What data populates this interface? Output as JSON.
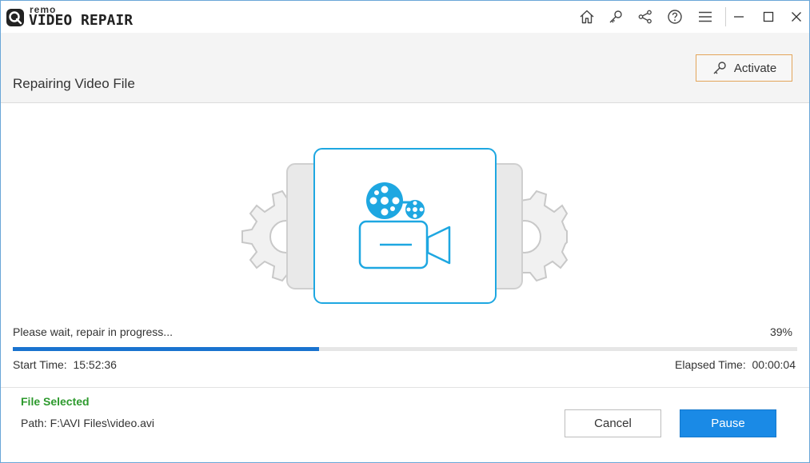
{
  "app": {
    "logo_small": "remo",
    "logo_big": "VIDEO REPAIR"
  },
  "titlebar": {
    "icons": [
      "home-icon",
      "key-icon",
      "share-icon",
      "help-icon",
      "menu-icon",
      "minimize-icon",
      "maximize-icon",
      "close-icon"
    ]
  },
  "header": {
    "title": "Repairing Video File",
    "activate_label": "Activate"
  },
  "progress": {
    "status": "Please wait, repair in progress...",
    "percent_label": "39%",
    "fraction": 0.39
  },
  "times": {
    "start_label": "Start Time:",
    "start_value": "15:52:36",
    "elapsed_label": "Elapsed Time:",
    "elapsed_value": "00:00:04"
  },
  "file": {
    "heading": "File Selected",
    "path": "Path: F:\\AVI Files\\video.avi"
  },
  "buttons": {
    "cancel": "Cancel",
    "pause": "Pause"
  },
  "colors": {
    "accent": "#1a8ae6",
    "progress": "#1a73cf",
    "success": "#2e9a2e",
    "activate_border": "#e3a55a",
    "illustration": "#1ea7e1"
  }
}
